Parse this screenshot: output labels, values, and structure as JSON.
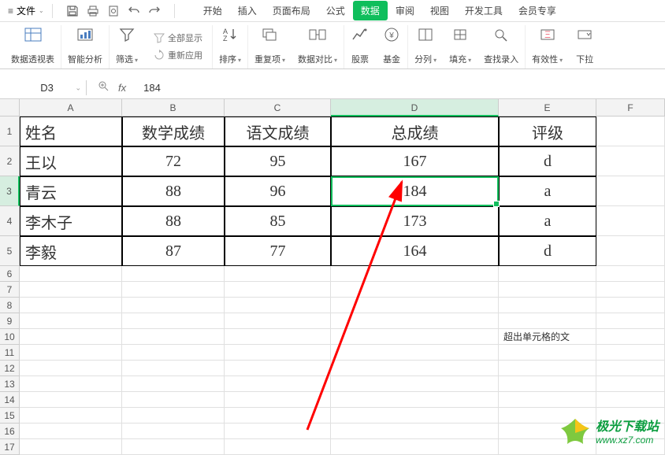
{
  "menu": {
    "file": "文件",
    "tabs": [
      "开始",
      "插入",
      "页面布局",
      "公式",
      "数据",
      "审阅",
      "视图",
      "开发工具",
      "会员专享",
      ""
    ],
    "active_tab_index": 4
  },
  "ribbon": {
    "pivot": "数据透视表",
    "smart": "智能分析",
    "filter": "筛选",
    "show_all": "全部显示",
    "reapply": "重新应用",
    "sort": "排序",
    "dupes": "重复项",
    "compare": "数据对比",
    "stocks": "股票",
    "funds": "基金",
    "split": "分列",
    "fill": "填充",
    "find_input": "查找录入",
    "validity": "有效性",
    "dropdown": "下拉"
  },
  "formula_bar": {
    "name_box": "D3",
    "formula": "184"
  },
  "columns": [
    "A",
    "B",
    "C",
    "D",
    "E",
    "F"
  ],
  "selected_col_index": 3,
  "selected_row_index": 2,
  "table": {
    "headers": [
      "姓名",
      "数学成绩",
      "语文成绩",
      "总成绩",
      "评级"
    ],
    "rows": [
      [
        "王以",
        "72",
        "95",
        "167",
        "d"
      ],
      [
        "青云",
        "88",
        "96",
        "184",
        "a"
      ],
      [
        "李木子",
        "88",
        "85",
        "173",
        "a"
      ],
      [
        "李毅",
        "87",
        "77",
        "164",
        "d"
      ]
    ]
  },
  "overflow_text": "超出单元格的文",
  "row_numbers": [
    "1",
    "2",
    "3",
    "4",
    "5",
    "6",
    "7",
    "8",
    "9",
    "10",
    "11",
    "12",
    "13",
    "14",
    "15",
    "16",
    "17"
  ],
  "watermark": {
    "title": "极光下载站",
    "url": "www.xz7.com"
  }
}
